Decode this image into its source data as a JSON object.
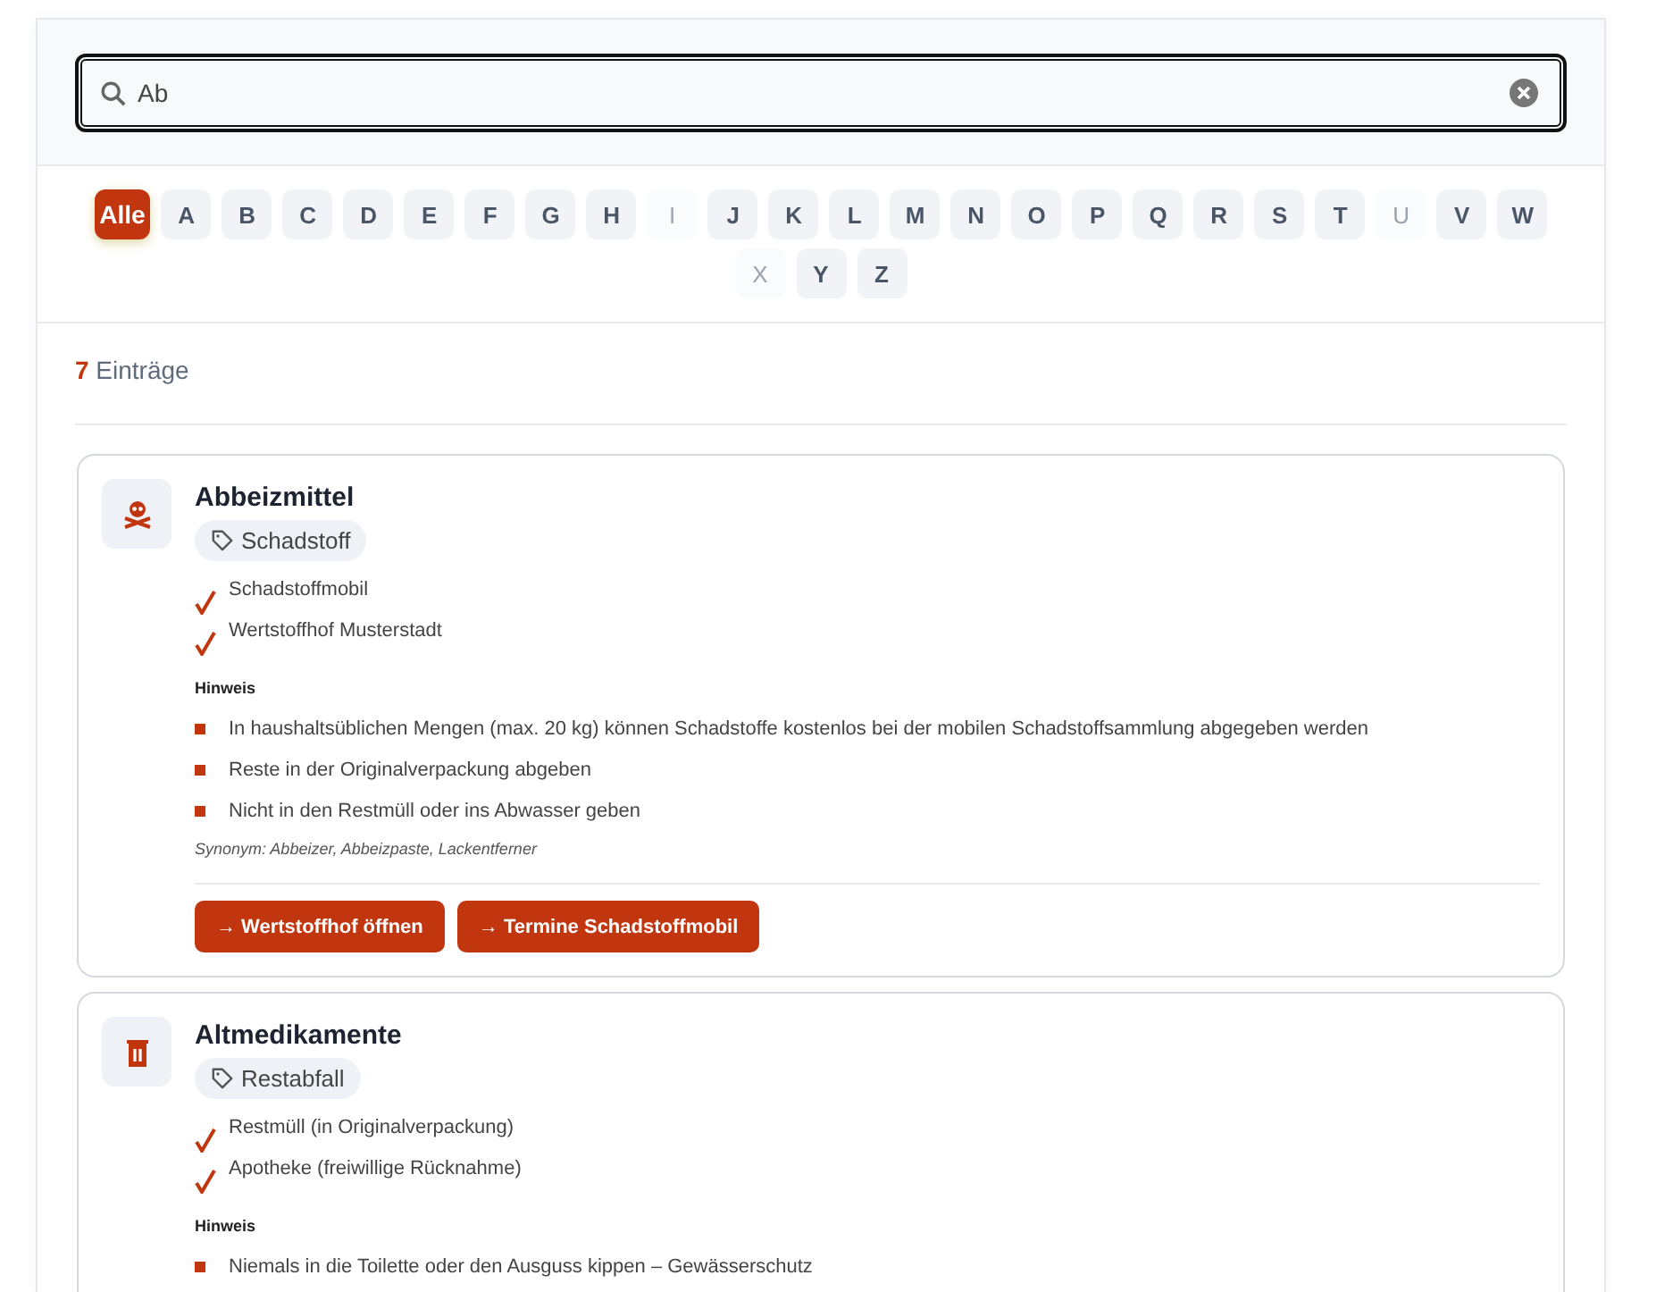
{
  "search": {
    "value": "Ab"
  },
  "letters": [
    {
      "label": "Alle",
      "selected": true,
      "disabled": false
    },
    {
      "label": "A",
      "selected": false,
      "disabled": false
    },
    {
      "label": "B",
      "selected": false,
      "disabled": false
    },
    {
      "label": "C",
      "selected": false,
      "disabled": false
    },
    {
      "label": "D",
      "selected": false,
      "disabled": false
    },
    {
      "label": "E",
      "selected": false,
      "disabled": false
    },
    {
      "label": "F",
      "selected": false,
      "disabled": false
    },
    {
      "label": "G",
      "selected": false,
      "disabled": false
    },
    {
      "label": "H",
      "selected": false,
      "disabled": false
    },
    {
      "label": "I",
      "selected": false,
      "disabled": true
    },
    {
      "label": "J",
      "selected": false,
      "disabled": false
    },
    {
      "label": "K",
      "selected": false,
      "disabled": false
    },
    {
      "label": "L",
      "selected": false,
      "disabled": false
    },
    {
      "label": "M",
      "selected": false,
      "disabled": false
    },
    {
      "label": "N",
      "selected": false,
      "disabled": false
    },
    {
      "label": "O",
      "selected": false,
      "disabled": false
    },
    {
      "label": "P",
      "selected": false,
      "disabled": false
    },
    {
      "label": "Q",
      "selected": false,
      "disabled": false
    },
    {
      "label": "R",
      "selected": false,
      "disabled": false
    },
    {
      "label": "S",
      "selected": false,
      "disabled": false
    },
    {
      "label": "T",
      "selected": false,
      "disabled": false
    },
    {
      "label": "U",
      "selected": false,
      "disabled": true
    },
    {
      "label": "V",
      "selected": false,
      "disabled": false
    },
    {
      "label": "W",
      "selected": false,
      "disabled": false
    },
    {
      "label": "X",
      "selected": false,
      "disabled": true
    },
    {
      "label": "Y",
      "selected": false,
      "disabled": false
    },
    {
      "label": "Z",
      "selected": false,
      "disabled": false
    }
  ],
  "result_count": {
    "number": "7",
    "label": "Einträge"
  },
  "entries": [
    {
      "kind": "hazard",
      "title": "Abbeizmittel",
      "category": "Schadstoff",
      "locations": [
        "Schadstoffmobil",
        "Wertstoffhof Musterstadt"
      ],
      "note_heading": "Hinweis",
      "notes": [
        "In haushaltsüblichen Mengen (max. 20 kg) können Schadstoffe kostenlos bei der mobilen Schadstoffsammlung abgegeben werden",
        "Reste in der Originalverpackung abgeben",
        "Nicht in den Restmüll oder ins Abwasser geben"
      ],
      "synonyms": "Synonym: Abbeizer, Abbeizpaste, Lackentferner",
      "actions": [
        "→ Wertstoffhof öffnen",
        "→ Termine Schadstoffmobil"
      ]
    },
    {
      "kind": "waste",
      "title": "Altmedikamente",
      "category": "Restabfall",
      "locations": [
        "Restmüll (in Originalverpackung)",
        "Apotheke (freiwillige Rücknahme)"
      ],
      "note_heading": "Hinweis",
      "notes": [
        "Niemals in die Toilette oder den Ausguss kippen – Gewässerschutz"
      ]
    }
  ]
}
